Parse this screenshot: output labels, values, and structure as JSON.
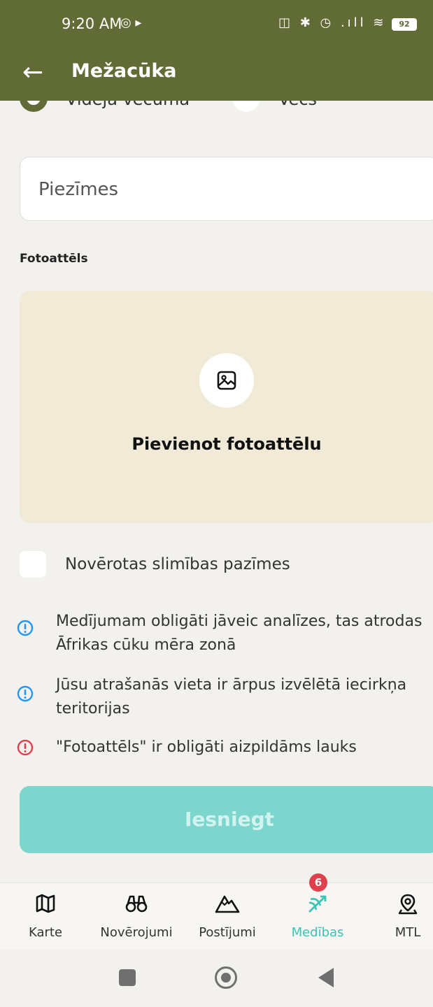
{
  "status_bar": {
    "time": "9:20 AM",
    "left_icons": "◎  ▸",
    "right_icons": "◫ ✱ ◷ .ıll ≋",
    "battery": "92"
  },
  "app_bar": {
    "title": "Mežacūka"
  },
  "age_options": [
    {
      "label": "Vidēja vecuma",
      "selected": true
    },
    {
      "label": "Vecs",
      "selected": false
    }
  ],
  "notes": {
    "placeholder": "Piezīmes"
  },
  "photo_section": {
    "label": "Fotoattēls",
    "add_text": "Pievienot fotoattēlu"
  },
  "disease_checkbox": {
    "label": "Novērotas slimības pazīmes",
    "checked": false
  },
  "messages": [
    {
      "type": "info",
      "text": "Medījumam obligāti jāveic analīzes, tas atrodas Āfrikas cūku mēra zonā"
    },
    {
      "type": "info",
      "text": "Jūsu atrašanās vieta ir ārpus izvēlētā iecirkņa teritorijas"
    },
    {
      "type": "error",
      "text": "\"Fotoattēls\" ir obligāti aizpildāms lauks"
    }
  ],
  "submit": {
    "label": "Iesniegt",
    "color": "#7dd6cd"
  },
  "bottom_nav": [
    {
      "label": "Karte",
      "icon": "map-icon"
    },
    {
      "label": "Novērojumi",
      "icon": "binoculars-icon"
    },
    {
      "label": "Postījumi",
      "icon": "mountain-icon"
    },
    {
      "label": "Medības",
      "icon": "hunting-icon",
      "badge": "6",
      "active": true
    },
    {
      "label": "MTL",
      "icon": "location-pin-icon"
    }
  ],
  "colors": {
    "header": "#616b35",
    "accent": "#3cc3b4",
    "info": "#2196f3",
    "error": "#e0404e"
  }
}
